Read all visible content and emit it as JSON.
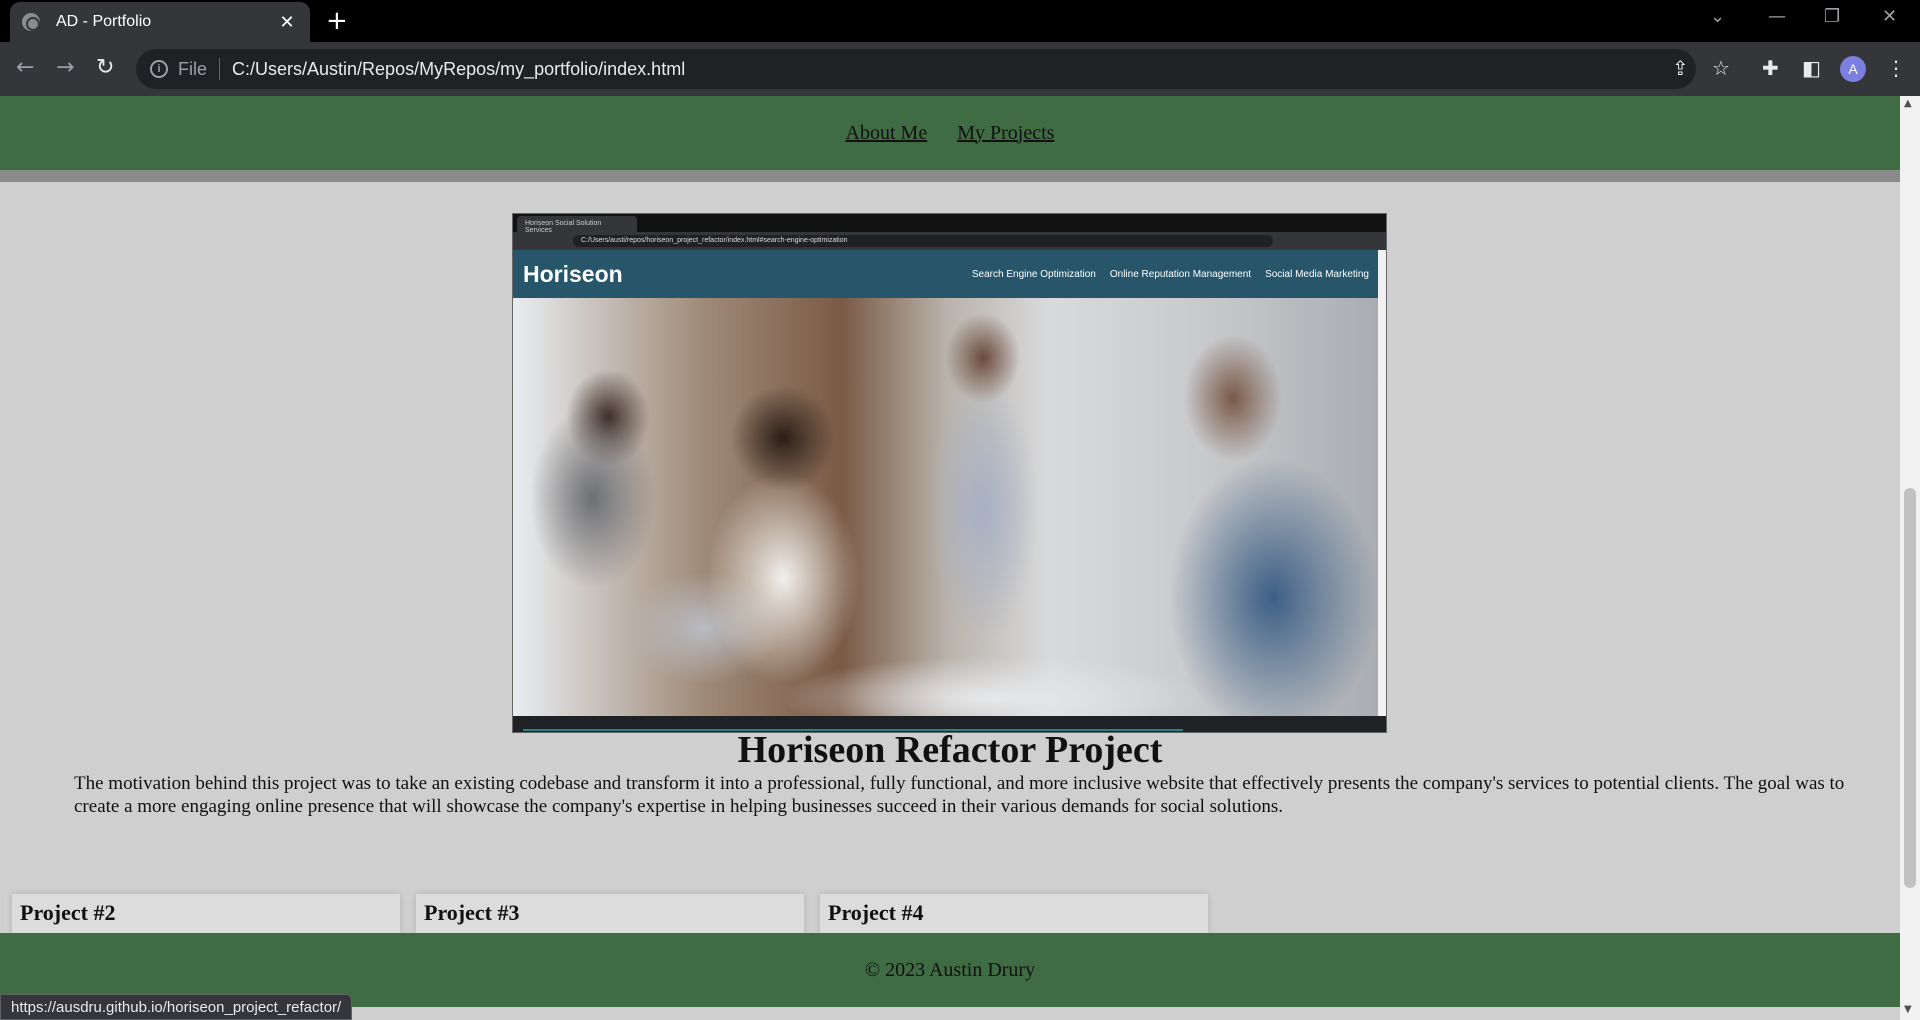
{
  "browser": {
    "tab_title": "AD - Portfolio",
    "tab_close": "✕",
    "new_tab": "+",
    "scheme_label": "File",
    "url": "C:/Users/Austin/Repos/MyRepos/my_portfolio/index.html",
    "profile_initial": "A",
    "status_url": "https://ausdru.github.io/horiseon_project_refactor/",
    "icons": [
      "back-icon",
      "forward-icon",
      "reload-icon",
      "info-icon",
      "share-icon",
      "star-icon",
      "extensions-icon",
      "side-panel-icon",
      "menu-icon"
    ]
  },
  "site": {
    "nav": [
      {
        "label": "About Me"
      },
      {
        "label": "My Projects"
      }
    ],
    "featured": {
      "screenshot": {
        "tab_title": "Horiseon Social Solution Services",
        "url": "C:/Users/austi/repos/horiseon_project_refactor/index.html#search-engine-optimization",
        "brand": "Horiseon",
        "links": [
          "Search Engine Optimization",
          "Online Reputation Management",
          "Social Media Marketing"
        ]
      },
      "title": "Horiseon Refactor Project",
      "description": "The motivation behind this project was to take an existing codebase and transform it into a professional, fully functional, and more inclusive website that effectively presents the company's services to potential clients. The goal was to create a more engaging online presence that will showcase the company's expertise in helping businesses succeed in their various demands for social solutions."
    },
    "cards": [
      {
        "title": "Project #2"
      },
      {
        "title": "Project #3"
      },
      {
        "title": "Project #4"
      }
    ],
    "footer": "© 2023 Austin Drury"
  },
  "colors": {
    "header_green": "#3f6c43",
    "page_bg": "#cfcfcf",
    "horiseon_blue": "#27566b"
  }
}
